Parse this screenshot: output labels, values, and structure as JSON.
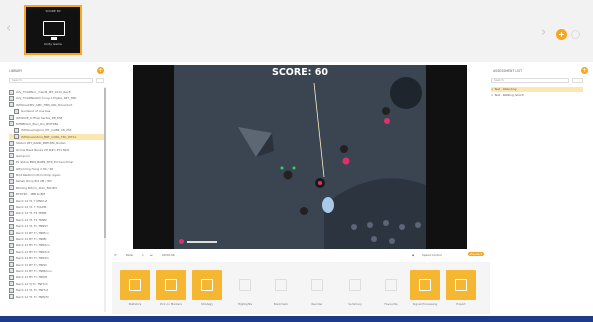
{
  "thumbnail": {
    "hud": "SCORE 60",
    "label": "Unity Game"
  },
  "left_panel": {
    "header": "LIBRARY",
    "search_placeholder": "Search",
    "items": [
      "Ally_TOURNnc_mainN_Mif_1024_Rec8",
      "Ally_TOURNbatch.hong.1.ErgKG_1BT_T8D",
      "ISTNoveCMV_AMC_TBN_URL_Nonaduct",
      "Guideout of one bas",
      "ISTNOVE_O ffrep Sertos_RB_ESE",
      "MTNBDLm_Elen_Rin_BlSTRBs",
      "ISTNoveimgtool_M7_m2BP_V8_2ST",
      "ISTNoveArrtool_BRT_mitRL_TRC_ZIT11",
      "Statud 1BT_RANK_BRTUMb_Rorte1",
      "Online Baek Books 2H M#n 8T1 Bkt1",
      "Gemprnd",
      "EL Stdne ERN_BABN_NTR_Ed bwrnhmar",
      "Gftxmmrg Hung 2 80 / 48",
      "Bmt Reldbmn Rtrm Rmjr Again",
      "Rehab Rmnj 8kt 2M / 8M",
      "Bkmihg Brtnru_Xhkr_Bkt Bht",
      "BTDTRY - 1BB ts BM",
      "Rwck 12 T1 7 MNM st",
      "Rwck 12 T1 7 TOLPM",
      "Rwck 12 T1 T4 TEtMt",
      "Rwck 12 T1 T2 TRNM",
      "Rwck 12 T1 Tn TNNST",
      "Rwck 12 BT Tn TNtEnn",
      "Rwck 12 BT Tn TNtBt",
      "Rwck 12 BT Tn TNtMnn",
      "Rwck 12 BT Tn TNtMnh",
      "Rwck 12 BT Tn TNtMm",
      "Rwck 12 BT Tn TNtSh",
      "Rwck 12 BT Tn TNtBmnn",
      "Rwck 12 BT Tn TNtMt",
      "Rwck 12 TJ Tn TNtTnh",
      "Rwck 12 T1 Tn TNtTnt",
      "Rwck 12 T1 Tn TNtN7h"
    ]
  },
  "video": {
    "score": "SCORE: 60"
  },
  "controls": {
    "speed": "Ratio",
    "time": "00:00:06",
    "volume_label": "Speed Control",
    "action": "Playback"
  },
  "toolbar": {
    "tools": [
      {
        "label": "Statistics",
        "active": true
      },
      {
        "label": "Pick on Markers",
        "active": true
      },
      {
        "label": "Strategy",
        "active": true
      },
      {
        "label": "Highlights",
        "active": false
      },
      {
        "label": "Bookmark",
        "active": false
      },
      {
        "label": "Reorder",
        "active": false
      },
      {
        "label": "Summary",
        "active": false
      },
      {
        "label": "Favourite",
        "active": false
      },
      {
        "label": "Signal Processing",
        "active": true
      },
      {
        "label": "Export",
        "active": true
      }
    ]
  },
  "right_panel": {
    "header": "ASSESSMENT LIST",
    "search_placeholder": "Search",
    "items": [
      {
        "label": "Test - Attending",
        "selected": true
      },
      {
        "label": "Test - Walking (short)",
        "selected": false
      }
    ]
  },
  "colors": {
    "accent": "#f5a623",
    "tool_active": "#f5b731",
    "game_bg": "#3b4552",
    "taskbar": "#1e3a8a"
  }
}
